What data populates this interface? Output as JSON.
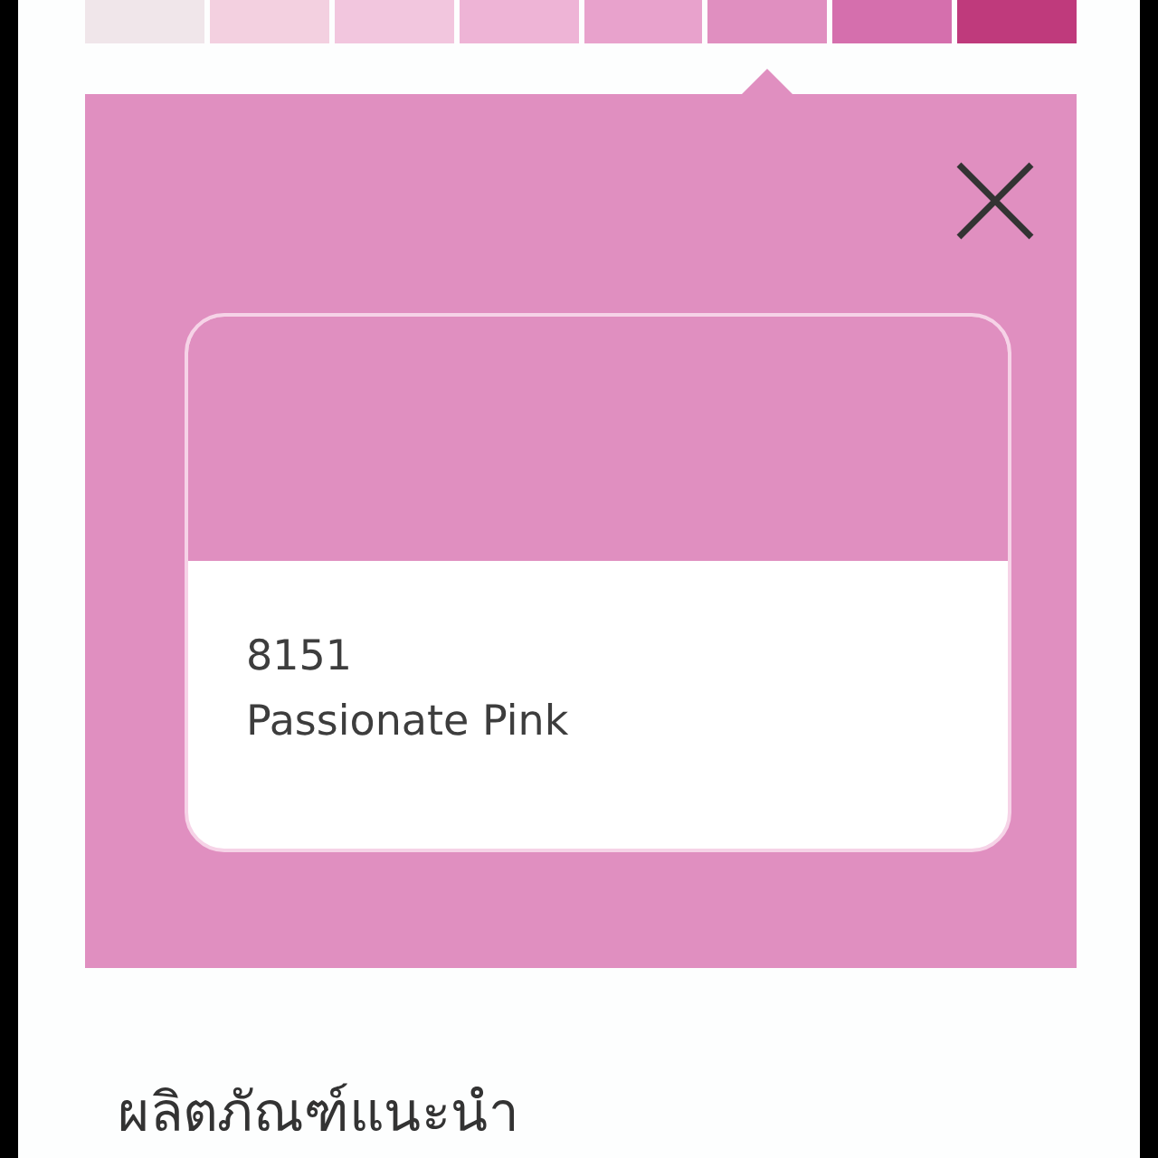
{
  "swatches": [
    {
      "color": "#f0e6ea",
      "selected": false
    },
    {
      "color": "#f3d0e0",
      "selected": false
    },
    {
      "color": "#f2c6de",
      "selected": false
    },
    {
      "color": "#eeb4d6",
      "selected": false
    },
    {
      "color": "#e8a2cc",
      "selected": false
    },
    {
      "color": "#e08fc0",
      "selected": true
    },
    {
      "color": "#d56fad",
      "selected": false
    },
    {
      "color": "#bf3a7c",
      "selected": false
    }
  ],
  "detail": {
    "code": "8151",
    "name": "Passionate Pink"
  },
  "section_title": "ผลิตภัณฑ์แนะนำ"
}
